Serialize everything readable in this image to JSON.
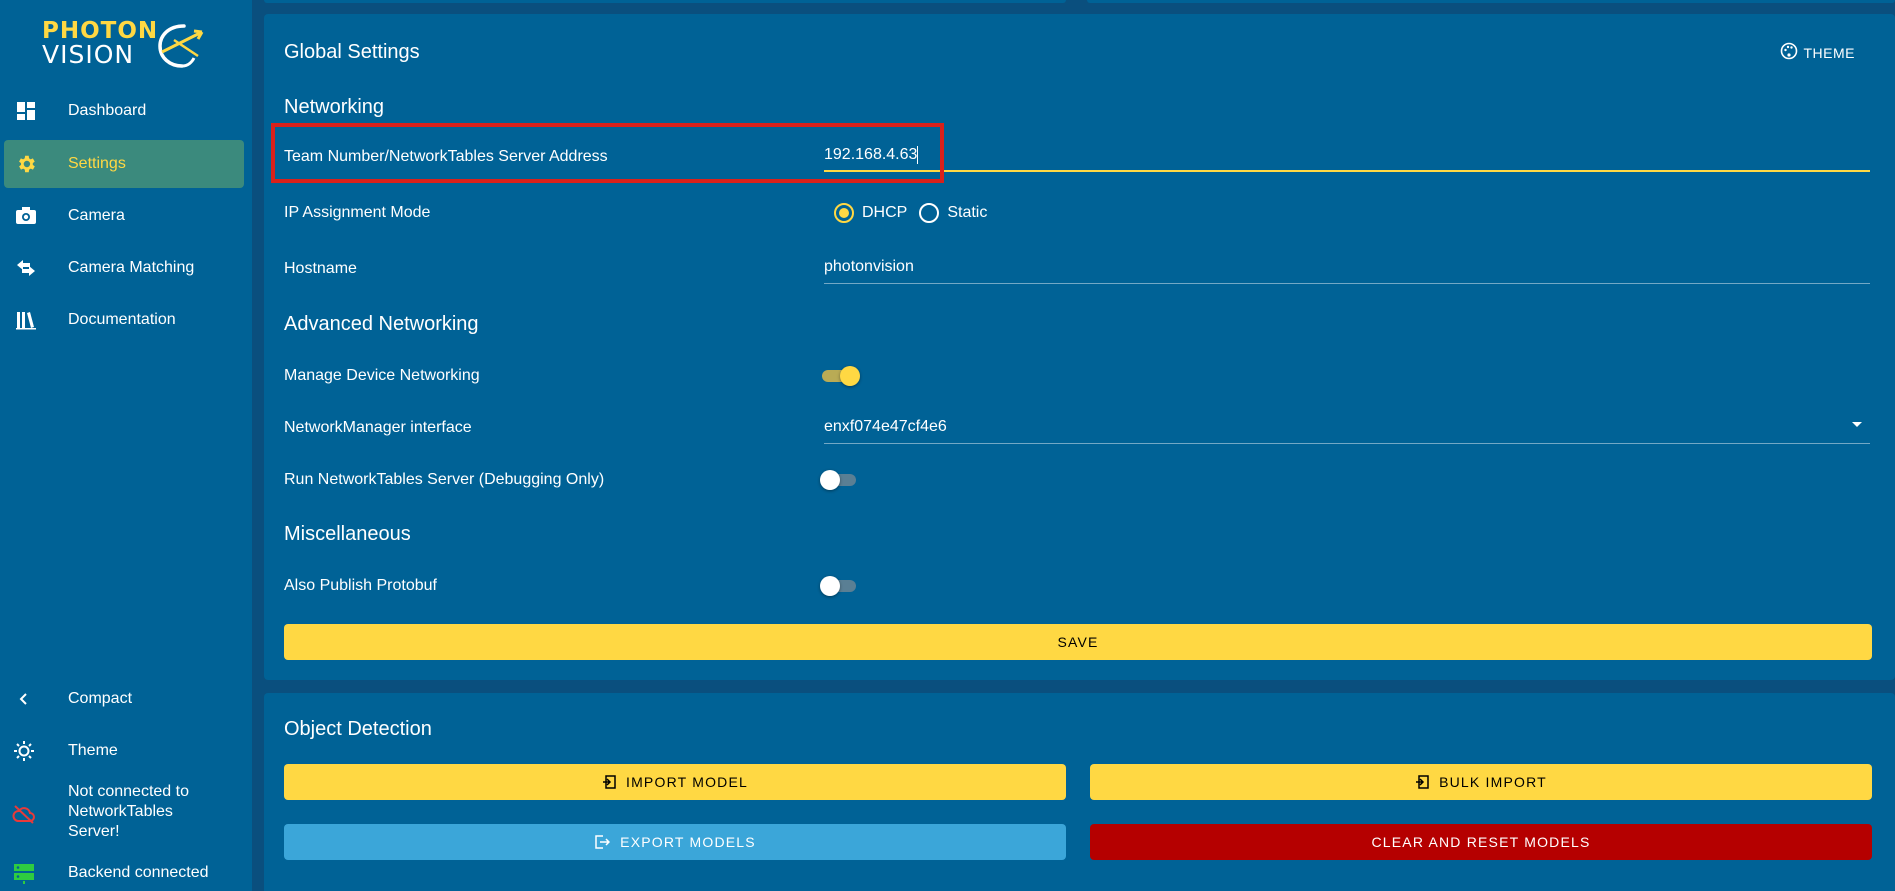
{
  "app": {
    "logo_top": "PHOTON",
    "logo_bottom": "VISION"
  },
  "sidebar": {
    "items": [
      {
        "label": "Dashboard",
        "icon": "dashboard-icon"
      },
      {
        "label": "Settings",
        "icon": "gear-icon",
        "active": true
      },
      {
        "label": "Camera",
        "icon": "camera-icon"
      },
      {
        "label": "Camera Matching",
        "icon": "swap-icon"
      },
      {
        "label": "Documentation",
        "icon": "books-icon"
      }
    ],
    "bottom": {
      "compact_label": "Compact",
      "theme_label": "Theme",
      "nt_status": "Not connected to NetworkTables Server!",
      "backend_status": "Backend connected"
    }
  },
  "global_settings": {
    "title": "Global Settings",
    "theme_button": "THEME",
    "networking": {
      "title": "Networking",
      "team_label": "Team Number/NetworkTables Server Address",
      "team_value": "192.168.4.63",
      "ip_mode_label": "IP Assignment Mode",
      "ip_mode_options": [
        "DHCP",
        "Static"
      ],
      "ip_mode_selected": "DHCP",
      "hostname_label": "Hostname",
      "hostname_value": "photonvision"
    },
    "advanced": {
      "title": "Advanced Networking",
      "manage_label": "Manage Device Networking",
      "manage_on": true,
      "interface_label": "NetworkManager interface",
      "interface_value": "enxf074e47cf4e6",
      "nt_server_label": "Run NetworkTables Server (Debugging Only)",
      "nt_server_on": false
    },
    "misc": {
      "title": "Miscellaneous",
      "protobuf_label": "Also Publish Protobuf",
      "protobuf_on": false
    },
    "save_label": "SAVE"
  },
  "object_detection": {
    "title": "Object Detection",
    "import_label": "IMPORT MODEL",
    "bulk_label": "BULK IMPORT",
    "export_label": "EXPORT MODELS",
    "clear_label": "CLEAR AND RESET MODELS"
  },
  "colors": {
    "sidebar_bg": "#006296",
    "accent_yellow": "#ffd843",
    "active_nav_bg": "#3b8a7d",
    "danger_red": "#b50000",
    "export_blue": "#3ba6d9",
    "highlight_red": "#d9211b"
  }
}
